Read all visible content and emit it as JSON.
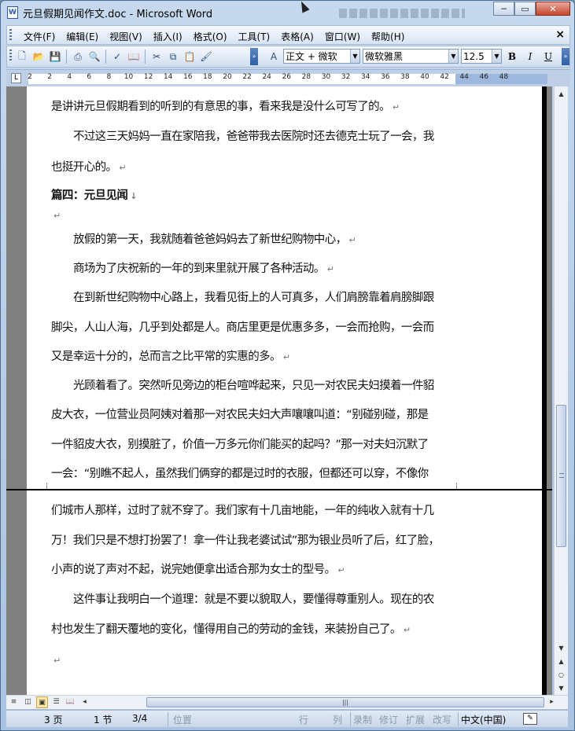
{
  "window": {
    "title": "元旦假期见闻作文.doc - Microsoft Word",
    "app_icon": "W"
  },
  "menu": {
    "items": [
      "文件(F)",
      "编辑(E)",
      "视图(V)",
      "插入(I)",
      "格式(O)",
      "工具(T)",
      "表格(A)",
      "窗口(W)",
      "帮助(H)"
    ],
    "close": "×"
  },
  "toolbar": {
    "style_value": "正文 + 微软",
    "font_value": "微软雅黑",
    "size_value": "12.5",
    "bold": "B",
    "italic": "I",
    "underline": "U"
  },
  "ruler": {
    "numbers": [
      "2",
      "2",
      "4",
      "6",
      "8",
      "10",
      "12",
      "14",
      "16",
      "18",
      "20",
      "22",
      "24",
      "26",
      "28",
      "30",
      "32",
      "34",
      "36",
      "38",
      "40",
      "42",
      "44",
      "46",
      "48"
    ]
  },
  "document": {
    "lines": [
      {
        "text": "是讲讲元旦假期看到的听到的有意思的事，看来我是没什么可写了的。",
        "mark": "↵",
        "indent": false,
        "heading": false
      },
      {
        "text": "不过这三天妈妈一直在家陪我，爸爸带我去医院时还去德克士玩了一会，我",
        "mark": "",
        "indent": true,
        "heading": false
      },
      {
        "text": "也挺开心的。",
        "mark": "↵",
        "indent": false,
        "heading": false
      },
      {
        "text": "篇四：元旦见闻",
        "mark": "↓",
        "indent": false,
        "heading": true
      },
      {
        "text": "",
        "mark": "↵",
        "indent": false,
        "heading": false
      },
      {
        "text": "放假的第一天，我就随着爸爸妈妈去了新世纪购物中心，",
        "mark": "↵",
        "indent": true,
        "heading": false
      },
      {
        "text": "商场为了庆祝新的一年的到来里就开展了各种活动。",
        "mark": "↵",
        "indent": true,
        "heading": false
      },
      {
        "text": "在到新世纪购物中心路上，我看见街上的人可真多，人们肩膀靠着肩膀脚跟",
        "mark": "",
        "indent": true,
        "heading": false
      },
      {
        "text": "脚尖，人山人海，几乎到处都是人。商店里更是优惠多多，一会而抢购，一会而",
        "mark": "",
        "indent": false,
        "heading": false
      },
      {
        "text": "又是幸运十分的，总而言之比平常的实惠的多。",
        "mark": "↵",
        "indent": false,
        "heading": false
      },
      {
        "text": "光顾着看了。突然听见旁边的柜台喧哗起来，只见一对农民夫妇摸着一件貂",
        "mark": "",
        "indent": true,
        "heading": false
      },
      {
        "text": "皮大衣，一位营业员阿姨对着那一对农民夫妇大声嚷嚷叫道：“别碰别碰，那是",
        "mark": "",
        "indent": false,
        "heading": false
      },
      {
        "text": "一件貂皮大衣，别摸脏了，价值一万多元你们能买的起吗？”那一对夫妇沉默了",
        "mark": "",
        "indent": false,
        "heading": false
      },
      {
        "text": "一会：“别瞧不起人，虽然我们俩穿的都是过时的衣服，但都还可以穿，不像你",
        "mark": "",
        "indent": false,
        "heading": false
      },
      {
        "text": "们城市人那样，过时了就不穿了。我们家有十几亩地能，一年的纯收入就有十几",
        "mark": "",
        "indent": false,
        "heading": false
      },
      {
        "text": "万！我们只是不想打扮罢了！拿一件让我老婆试试”那为银业员听了后，红了脸，",
        "mark": "",
        "indent": false,
        "heading": false
      },
      {
        "text": "小声的说了声对不起，说完她便拿出适合那为女士的型号。",
        "mark": "↵",
        "indent": false,
        "heading": false
      },
      {
        "text": "这件事让我明白一个道理：就是不要以貌取人，要懂得尊重别人。现在的农",
        "mark": "",
        "indent": true,
        "heading": false
      },
      {
        "text": "村也发生了翻天覆地的变化，懂得用自己的劳动的金钱，来装扮自己了。",
        "mark": "↵",
        "indent": false,
        "heading": false
      },
      {
        "text": "",
        "mark": "↵",
        "indent": false,
        "heading": false
      }
    ]
  },
  "statusbar": {
    "page": "3 页",
    "section": "1 节",
    "page_of": "3/4",
    "position": "位置",
    "line": "行",
    "column": "列",
    "rec": "录制",
    "trk": "修订",
    "ext": "扩展",
    "ovr": "改写",
    "language": "中文(中国)"
  }
}
